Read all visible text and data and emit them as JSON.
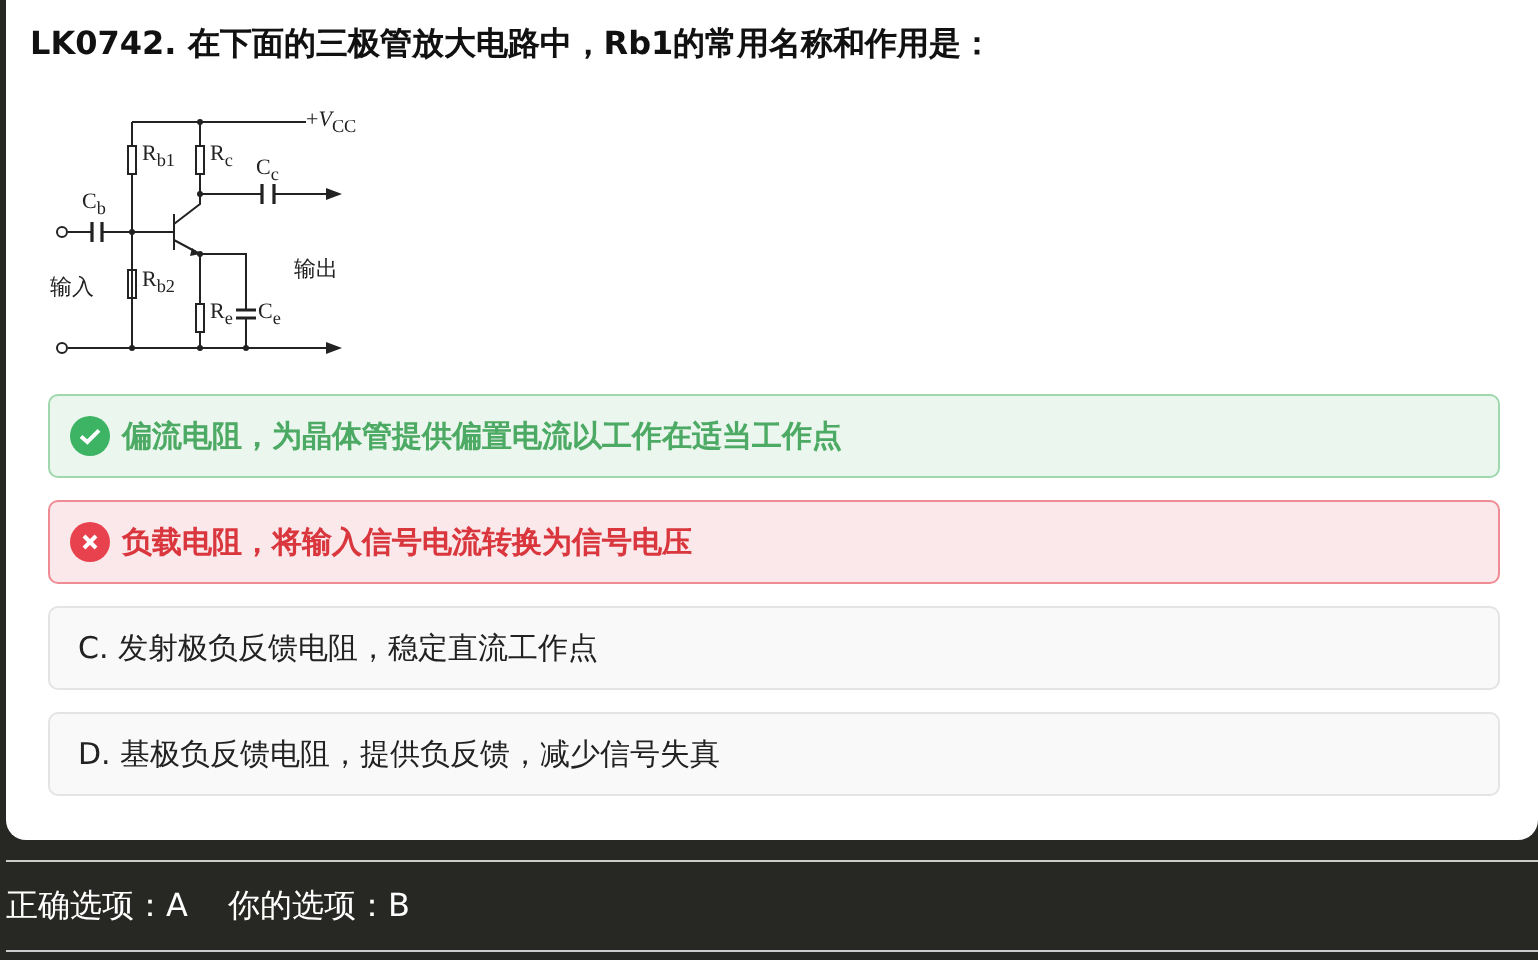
{
  "question": {
    "title": "LK0742. 在下面的三极管放大电路中，Rb1的常用名称和作用是：",
    "diagram_labels": [
      "+*V*$_{CC}$",
      "R$_{b1}$",
      "R$_{c}$",
      "C$_{c}$",
      "C$_{b}$",
      "输入",
      "R$_{b2}$",
      "输出",
      "R$_{e}$",
      "C$_{e}$"
    ]
  },
  "options": [
    {
      "kind": "correct",
      "text": "偏流电阻，为晶体管提供偏置电流以工作在适当工作点"
    },
    {
      "kind": "wrong",
      "text": "负载电阻，将输入信号电流转换为信号电压"
    },
    {
      "kind": "plain",
      "text": "C. 发射极负反馈电阻，稳定直流工作点"
    },
    {
      "kind": "plain",
      "text": "D. 基极负反馈电阻，提供负反馈，减少信号失真"
    }
  ],
  "result": {
    "correct": "正确选项：A",
    "yours": "你的选项：B"
  }
}
